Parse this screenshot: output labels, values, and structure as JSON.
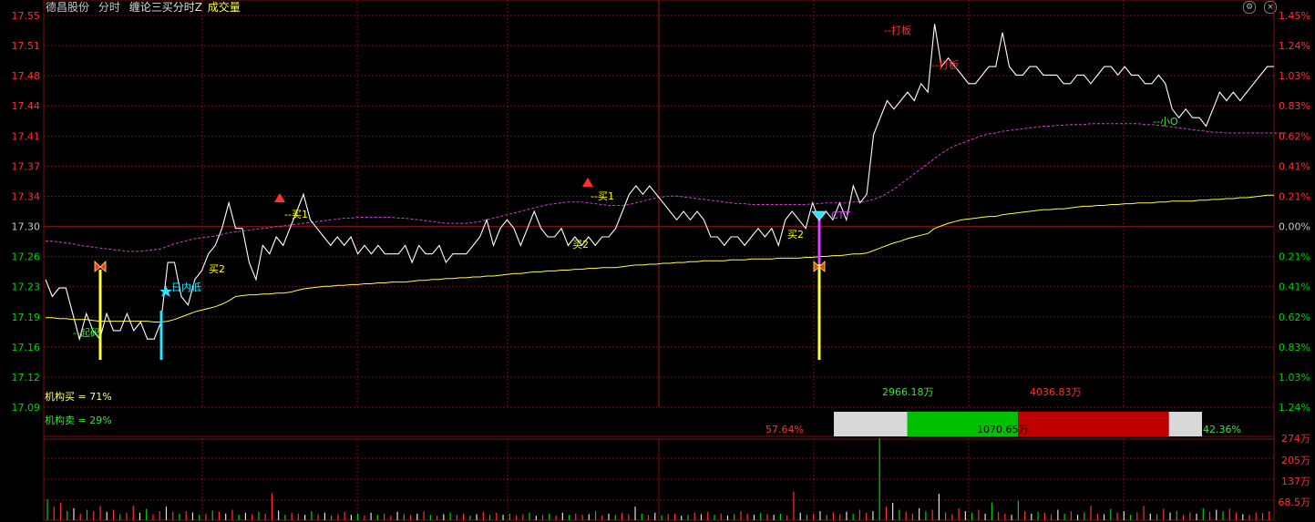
{
  "header": {
    "stock_name": "德昌股份",
    "view": "分时",
    "indicator": "缠论三买分时Z",
    "volume_label": "成交量"
  },
  "window_icons": [
    "settings-icon",
    "close-icon"
  ],
  "colors": {
    "background": "#000000",
    "grid": "#7a1010",
    "up": "#ff3030",
    "down": "#00d000",
    "neutral": "#c8c8c8",
    "price_line": "#ffffff",
    "avg_line": "#ffff40",
    "ma_line": "#d040d0",
    "text_yellow": "#ffff00",
    "text_green": "#40e040",
    "text_red": "#ff3030",
    "cyan": "#30e0ff",
    "magenta": "#e040ff"
  },
  "price_axis": {
    "left": [
      "17.55",
      "17.51",
      "17.48",
      "17.44",
      "17.41",
      "17.37",
      "17.34",
      "17.30",
      "17.26",
      "17.23",
      "17.19",
      "17.16",
      "17.12",
      "17.09"
    ],
    "right": [
      "1.45%",
      "1.24%",
      "1.03%",
      "0.83%",
      "0.62%",
      "0.41%",
      "0.21%",
      "0.00%",
      "0.21%",
      "0.41%",
      "0.62%",
      "0.83%",
      "1.03%",
      "1.24%"
    ],
    "prev_close": 17.3
  },
  "volume_axis": {
    "right": [
      "274万",
      "205万",
      "137万",
      "68.5万"
    ]
  },
  "annotations": {
    "buy1_a": "--买1",
    "buy1_b": "--买1",
    "buy2_a": "买2",
    "buy2_b": "买2",
    "buy2_c": "买2",
    "daily_low": "日内低",
    "ctt": "CTT",
    "daban_1": "--打板",
    "daban_2": "--打板",
    "xiaoO": "--小O",
    "qi_ma": "--起码"
  },
  "institution": {
    "buy_label": "机构买 = 71%",
    "sell_label": "机构卖 = 29%"
  },
  "flow_bar": {
    "left_pct": "57.64%",
    "right_pct": "42.36%",
    "green_value": "2966.18万",
    "red_value": "4036.83万",
    "center_value": "1070.65万",
    "segments": {
      "gray_left": 0.2,
      "green": 0.3,
      "red": 0.41,
      "gray_right": 0.09
    }
  },
  "chart_data": {
    "type": "line",
    "ylim": [
      17.09,
      17.55
    ],
    "series": [
      {
        "values": [
          17.24,
          17.22,
          17.23,
          17.23,
          17.2,
          17.17,
          17.2,
          17.18,
          17.17,
          17.2,
          17.18,
          17.18,
          17.2,
          17.18,
          17.19,
          17.17,
          17.17,
          17.19,
          17.26,
          17.26,
          17.22,
          17.21,
          17.24,
          17.25,
          17.27,
          17.28,
          17.3,
          17.33,
          17.3,
          17.3,
          17.26,
          17.24,
          17.28,
          17.27,
          17.29,
          17.28,
          17.3,
          17.32,
          17.34,
          17.31,
          17.3,
          17.29,
          17.28,
          17.29,
          17.28,
          17.29,
          17.27,
          17.28,
          17.27,
          17.28,
          17.27,
          17.27,
          17.27,
          17.28,
          17.26,
          17.28,
          17.27,
          17.27,
          17.28,
          17.26,
          17.27,
          17.27,
          17.27,
          17.28,
          17.29,
          17.31,
          17.28,
          17.3,
          17.31,
          17.3,
          17.28,
          17.3,
          17.32,
          17.3,
          17.29,
          17.29,
          17.3,
          17.28,
          17.29,
          17.28,
          17.29,
          17.28,
          17.29,
          17.29,
          17.3,
          17.32,
          17.34,
          17.35,
          17.34,
          17.35,
          17.34,
          17.33,
          17.32,
          17.31,
          17.32,
          17.31,
          17.32,
          17.31,
          17.29,
          17.29,
          17.28,
          17.29,
          17.29,
          17.28,
          17.29,
          17.3,
          17.29,
          17.3,
          17.28,
          17.31,
          17.32,
          17.31,
          17.3,
          17.33,
          17.31,
          17.32,
          17.31,
          17.33,
          17.31,
          17.35,
          17.33,
          17.34,
          17.41,
          17.43,
          17.45,
          17.44,
          17.45,
          17.46,
          17.45,
          17.47,
          17.46,
          17.54,
          17.49,
          17.5,
          17.49,
          17.48,
          17.47,
          17.47,
          17.48,
          17.49,
          17.49,
          17.53,
          17.49,
          17.48,
          17.48,
          17.49,
          17.49,
          17.48,
          17.48,
          17.48,
          17.47,
          17.47,
          17.48,
          17.48,
          17.47,
          17.48,
          17.49,
          17.49,
          17.48,
          17.49,
          17.48,
          17.48,
          17.47,
          17.47,
          17.48,
          17.47,
          17.44,
          17.43,
          17.44,
          17.43,
          17.43,
          17.42,
          17.44,
          17.46,
          17.45,
          17.46,
          17.45,
          17.46,
          17.47,
          17.48,
          17.49,
          17.49
        ]
      },
      {
        "values": [
          17.195,
          17.195,
          17.194,
          17.194,
          17.193,
          17.193,
          17.193,
          17.192,
          17.191,
          17.191,
          17.191,
          17.191,
          17.191,
          17.191,
          17.191,
          17.191,
          17.19,
          17.19,
          17.191,
          17.193,
          17.196,
          17.199,
          17.202,
          17.204,
          17.206,
          17.208,
          17.211,
          17.215,
          17.22,
          17.221,
          17.222,
          17.222,
          17.223,
          17.223,
          17.224,
          17.224,
          17.225,
          17.227,
          17.229,
          17.23,
          17.231,
          17.232,
          17.232,
          17.233,
          17.233,
          17.234,
          17.234,
          17.235,
          17.235,
          17.236,
          17.236,
          17.237,
          17.237,
          17.237,
          17.238,
          17.239,
          17.239,
          17.24,
          17.24,
          17.241,
          17.241,
          17.242,
          17.242,
          17.243,
          17.243,
          17.244,
          17.244,
          17.245,
          17.246,
          17.247,
          17.247,
          17.248,
          17.249,
          17.249,
          17.25,
          17.25,
          17.251,
          17.251,
          17.252,
          17.252,
          17.253,
          17.253,
          17.254,
          17.254,
          17.254,
          17.255,
          17.256,
          17.257,
          17.257,
          17.258,
          17.258,
          17.259,
          17.259,
          17.26,
          17.26,
          17.261,
          17.261,
          17.262,
          17.262,
          17.262,
          17.262,
          17.263,
          17.263,
          17.263,
          17.264,
          17.264,
          17.264,
          17.264,
          17.265,
          17.265,
          17.265,
          17.265,
          17.266,
          17.266,
          17.267,
          17.267,
          17.268,
          17.268,
          17.269,
          17.27,
          17.27,
          17.271,
          17.274,
          17.277,
          17.28,
          17.283,
          17.285,
          17.288,
          17.29,
          17.292,
          17.294,
          17.3,
          17.303,
          17.306,
          17.308,
          17.31,
          17.311,
          17.312,
          17.313,
          17.314,
          17.314,
          17.316,
          17.317,
          17.318,
          17.319,
          17.32,
          17.321,
          17.322,
          17.322,
          17.323,
          17.323,
          17.324,
          17.325,
          17.326,
          17.326,
          17.327,
          17.327,
          17.328,
          17.328,
          17.329,
          17.329,
          17.33,
          17.33,
          17.33,
          17.331,
          17.331,
          17.332,
          17.332,
          17.332,
          17.332,
          17.333,
          17.333,
          17.334,
          17.334,
          17.335,
          17.335,
          17.336,
          17.336,
          17.337,
          17.338,
          17.339,
          17.339
        ]
      },
      {
        "values": [
          17.285,
          17.285,
          17.284,
          17.283,
          17.282,
          17.28,
          17.279,
          17.278,
          17.277,
          17.276,
          17.275,
          17.274,
          17.273,
          17.273,
          17.273,
          17.274,
          17.275,
          17.276,
          17.279,
          17.282,
          17.284,
          17.286,
          17.288,
          17.289,
          17.29,
          17.291,
          17.293,
          17.295,
          17.296,
          17.297,
          17.298,
          17.299,
          17.3,
          17.301,
          17.302,
          17.303,
          17.304,
          17.305,
          17.306,
          17.307,
          17.308,
          17.309,
          17.31,
          17.311,
          17.312,
          17.312,
          17.313,
          17.313,
          17.313,
          17.313,
          17.313,
          17.313,
          17.312,
          17.312,
          17.311,
          17.31,
          17.309,
          17.308,
          17.307,
          17.306,
          17.306,
          17.306,
          17.306,
          17.307,
          17.308,
          17.31,
          17.312,
          17.314,
          17.316,
          17.318,
          17.32,
          17.322,
          17.324,
          17.326,
          17.328,
          17.329,
          17.33,
          17.331,
          17.331,
          17.331,
          17.33,
          17.329,
          17.328,
          17.327,
          17.327,
          17.327,
          17.328,
          17.33,
          17.332,
          17.334,
          17.336,
          17.337,
          17.338,
          17.338,
          17.337,
          17.336,
          17.335,
          17.334,
          17.333,
          17.332,
          17.331,
          17.33,
          17.329,
          17.329,
          17.328,
          17.328,
          17.328,
          17.328,
          17.328,
          17.328,
          17.328,
          17.328,
          17.328,
          17.329,
          17.329,
          17.33,
          17.33,
          17.33,
          17.33,
          17.331,
          17.331,
          17.332,
          17.334,
          17.337,
          17.341,
          17.346,
          17.352,
          17.358,
          17.364,
          17.37,
          17.376,
          17.382,
          17.388,
          17.393,
          17.397,
          17.4,
          17.403,
          17.406,
          17.409,
          17.411,
          17.412,
          17.414,
          17.415,
          17.416,
          17.417,
          17.418,
          17.419,
          17.42,
          17.42,
          17.421,
          17.421,
          17.422,
          17.422,
          17.422,
          17.423,
          17.423,
          17.423,
          17.423,
          17.423,
          17.423,
          17.423,
          17.423,
          17.422,
          17.422,
          17.421,
          17.42,
          17.419,
          17.418,
          17.417,
          17.416,
          17.415,
          17.414,
          17.413,
          17.413,
          17.412,
          17.412,
          17.412,
          17.412,
          17.412,
          17.412,
          17.412,
          17.412,
          17.412,
          17.412
        ]
      }
    ],
    "volume": {
      "ylim": [
        0,
        274
      ],
      "values": [
        70,
        45,
        58,
        30,
        40,
        22,
        35,
        30,
        48,
        28,
        35,
        20,
        25,
        48,
        25,
        38,
        20,
        30,
        45,
        28,
        22,
        30,
        26,
        18,
        22,
        32,
        28,
        22,
        35,
        18,
        25,
        20,
        28,
        22,
        90,
        32,
        18,
        25,
        22,
        18,
        30,
        20,
        25,
        16,
        20,
        28,
        18,
        22,
        16,
        25,
        18,
        22,
        15,
        28,
        20,
        18,
        22,
        30,
        18,
        15,
        20,
        26,
        18,
        22,
        16,
        20,
        28,
        18,
        25,
        18,
        22,
        16,
        20,
        26,
        15,
        18,
        22,
        16,
        25,
        18,
        22,
        18,
        20,
        30,
        15,
        22,
        18,
        25,
        20,
        45,
        22,
        18,
        25,
        16,
        20,
        22,
        15,
        18,
        25,
        20,
        28,
        18,
        22,
        16,
        20,
        30,
        22,
        18,
        25,
        20,
        18,
        22,
        16,
        95,
        25,
        18,
        22,
        30,
        18,
        26,
        20,
        28,
        22,
        35,
        25,
        30,
        274,
        45,
        58,
        35,
        28,
        22,
        40,
        30,
        35,
        88,
        26,
        20,
        40,
        30,
        25,
        35,
        22,
        60,
        28,
        22,
        18,
        65,
        30,
        22,
        28,
        25,
        20,
        35,
        22,
        30,
        18,
        26,
        48,
        22,
        20,
        38,
        25,
        30,
        18,
        26,
        48,
        22,
        20,
        38,
        25,
        30,
        18,
        26,
        22,
        40,
        28,
        35,
        30,
        38,
        26,
        20,
        18,
        25,
        24,
        30
      ],
      "colors": [
        "g",
        "r",
        "r",
        "g",
        "w",
        "r",
        "g",
        "r",
        "r",
        "w",
        "r",
        "g",
        "r",
        "r",
        "w",
        "g",
        "r",
        "r",
        "w",
        "r",
        "g",
        "r",
        "w",
        "g",
        "r",
        "g",
        "r",
        "w",
        "r",
        "g",
        "w",
        "r",
        "g",
        "r",
        "r",
        "w",
        "g",
        "r",
        "r",
        "w",
        "g",
        "r",
        "w",
        "g",
        "r",
        "r",
        "w",
        "g",
        "r",
        "w",
        "g",
        "r",
        "r",
        "w",
        "g",
        "r",
        "w",
        "r",
        "g",
        "r",
        "w",
        "g",
        "r",
        "r",
        "g",
        "w",
        "r",
        "g",
        "r",
        "w",
        "g",
        "r",
        "r",
        "g",
        "w",
        "r",
        "g",
        "r",
        "w",
        "g",
        "r",
        "r",
        "w",
        "g",
        "r",
        "w",
        "g",
        "r",
        "r",
        "w",
        "g",
        "r",
        "w",
        "g",
        "r",
        "r",
        "w",
        "g",
        "r",
        "w",
        "r",
        "g",
        "r",
        "w",
        "g",
        "r",
        "r",
        "w",
        "g",
        "r",
        "w",
        "g",
        "r",
        "r",
        "w",
        "g",
        "r",
        "w",
        "g",
        "r",
        "r",
        "w",
        "g",
        "r",
        "r",
        "w",
        "g",
        "r",
        "w",
        "g",
        "r",
        "r",
        "w",
        "g",
        "r",
        "w",
        "g",
        "r",
        "r",
        "w",
        "g",
        "r",
        "w",
        "g",
        "r",
        "r",
        "w",
        "g",
        "r",
        "w",
        "g",
        "r",
        "r",
        "w",
        "g",
        "r",
        "w",
        "g",
        "r",
        "r",
        "w",
        "g",
        "r",
        "w",
        "g",
        "r",
        "r",
        "w",
        "g",
        "r",
        "w",
        "g",
        "r",
        "r",
        "w",
        "g",
        "r",
        "w",
        "g",
        "r",
        "r",
        "w"
      ]
    }
  }
}
